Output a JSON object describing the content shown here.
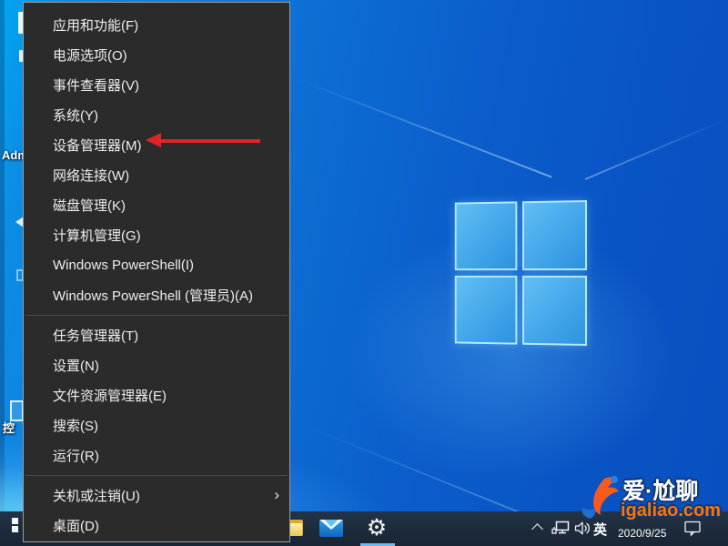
{
  "context_menu": {
    "items": [
      {
        "label": "应用和功能(F)"
      },
      {
        "label": "电源选项(O)"
      },
      {
        "label": "事件查看器(V)"
      },
      {
        "label": "系统(Y)"
      },
      {
        "label": "设备管理器(M)"
      },
      {
        "label": "网络连接(W)"
      },
      {
        "label": "磁盘管理(K)"
      },
      {
        "label": "计算机管理(G)"
      },
      {
        "label": "Windows PowerShell(I)"
      },
      {
        "label": "Windows PowerShell (管理员)(A)"
      },
      {
        "label": "任务管理器(T)"
      },
      {
        "label": "设置(N)"
      },
      {
        "label": "文件资源管理器(E)"
      },
      {
        "label": "搜索(S)"
      },
      {
        "label": "运行(R)"
      },
      {
        "label": "关机或注销(U)",
        "has_submenu": true,
        "submenu_glyph": "›"
      },
      {
        "label": "桌面(D)"
      }
    ]
  },
  "annotation": {
    "arrow_points_to": "设备管理器(M)",
    "arrow_color": "#e2232a"
  },
  "desktop": {
    "partial_icon_labels": {
      "first": "Adm",
      "second": "控"
    },
    "icons": [
      "windows-wallpaper-logo"
    ]
  },
  "taskbar": {
    "icons": {
      "start": "windows-logo-partial",
      "file_explorer": "folder-icon",
      "mail": "mail-icon",
      "settings_glyph": "⚙"
    },
    "tray": {
      "hidden_icons": "chevron-up-icon",
      "network": "ethernet-icon",
      "volume": "speaker-icon",
      "ime_indicator": "英",
      "date": "2020/9/25",
      "notifications": "action-center-icon"
    }
  },
  "watermark": {
    "brand": "爱·尬聊",
    "site": "igaliao.com",
    "accent_color": "#ff7400"
  }
}
